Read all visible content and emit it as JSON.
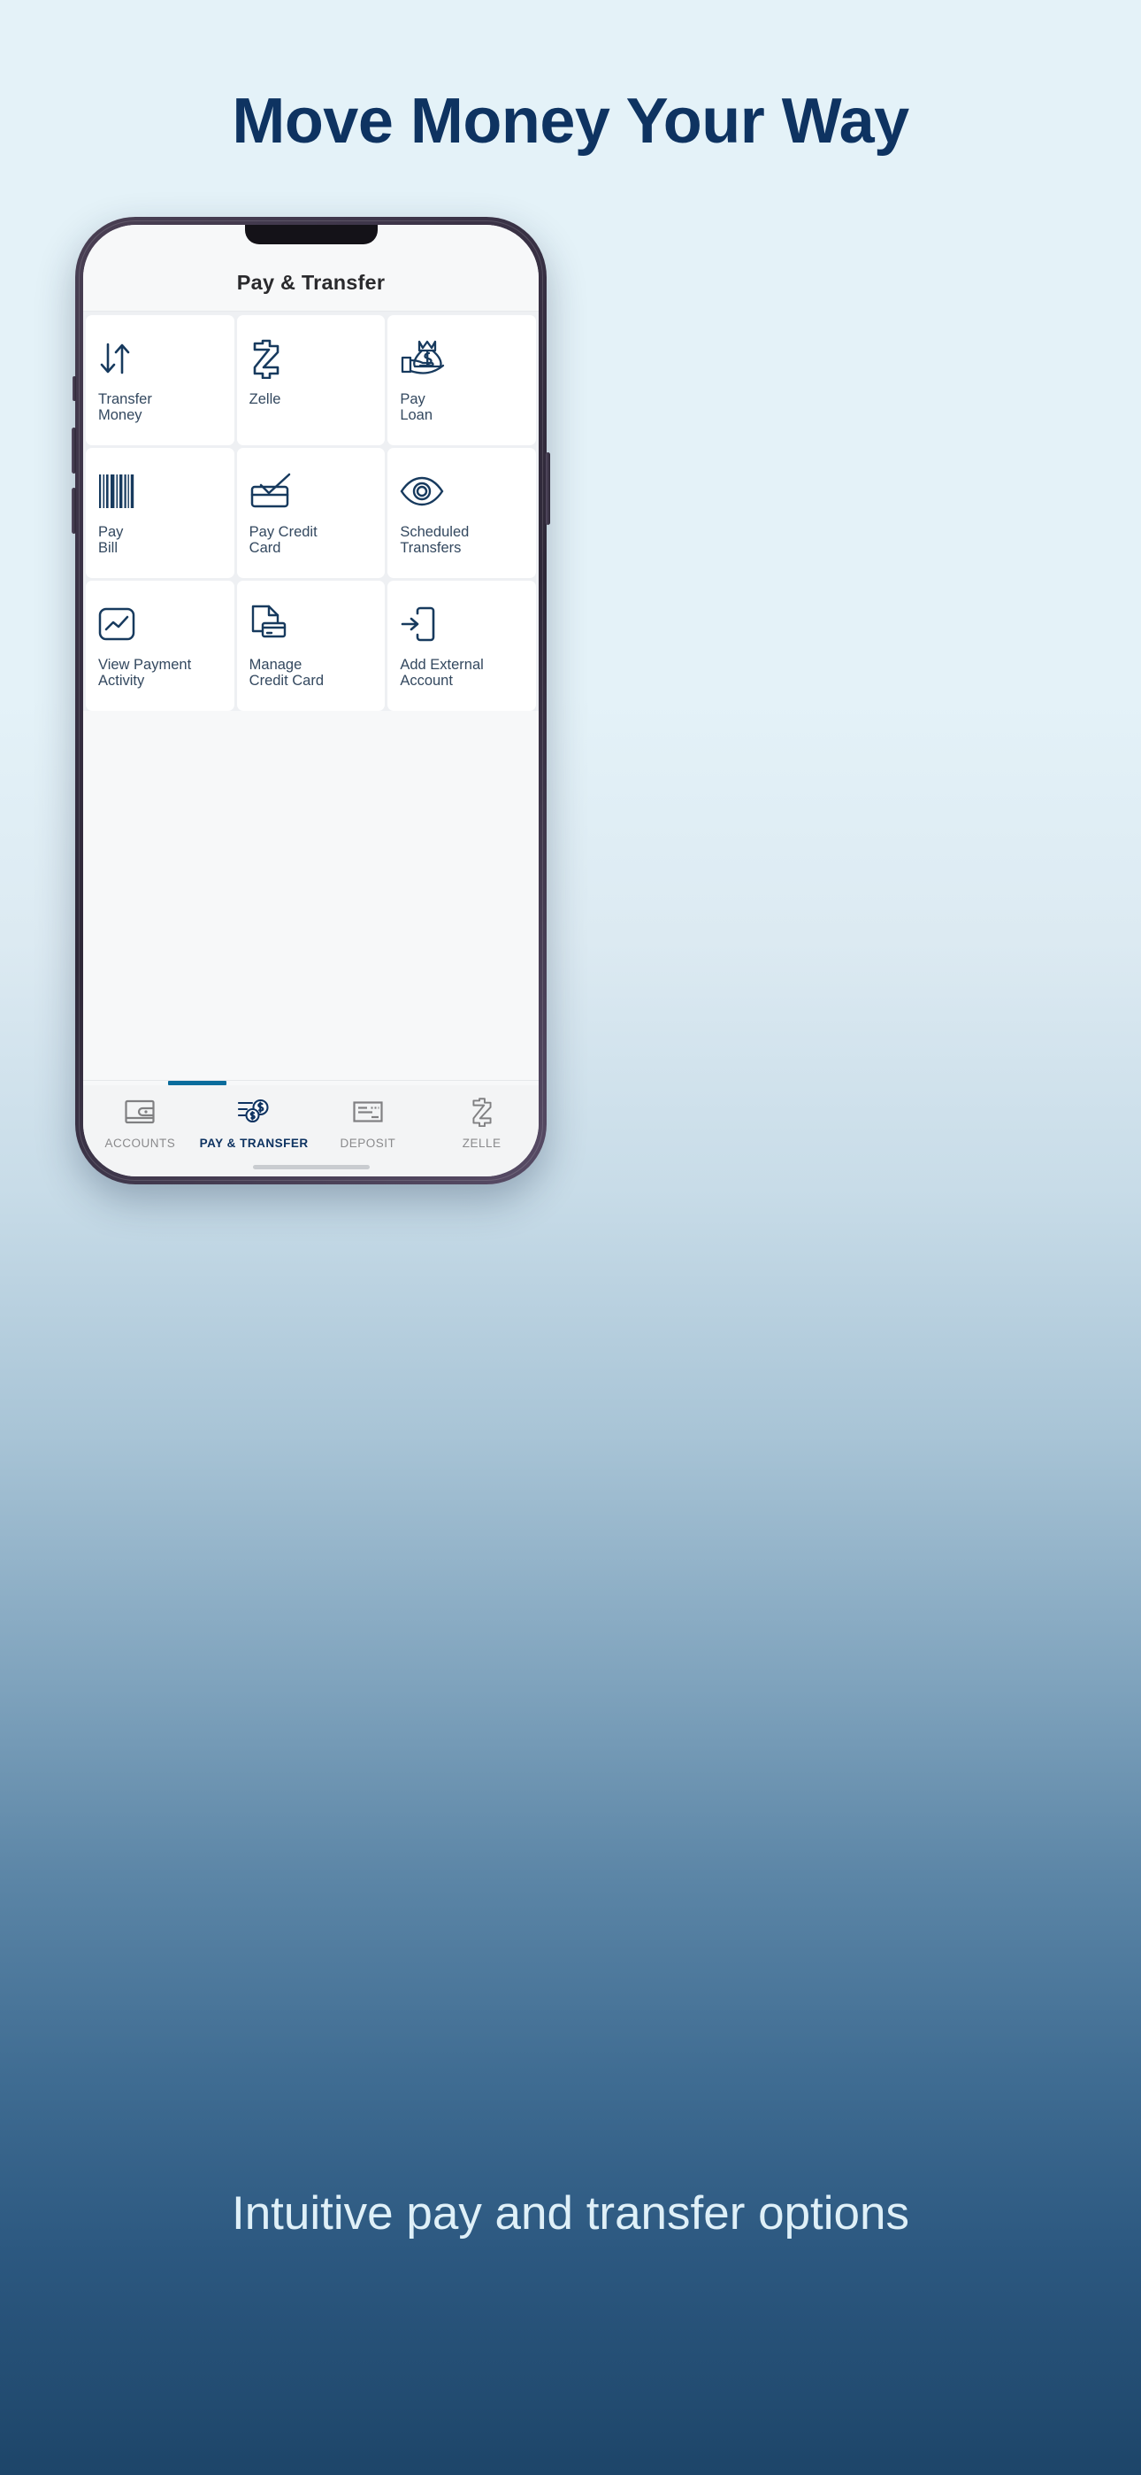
{
  "promo": {
    "headline": "Move Money Your Way",
    "caption": "Intuitive pay and transfer options",
    "headline_color": "#0e3361",
    "caption_color": "#dff0f8",
    "bg_top_color": "#e4f2f8",
    "bg_bottom_color": "#1d4569"
  },
  "app": {
    "header_title": "Pay & Transfer",
    "accent_color": "#0a6c9c",
    "icon_color": "#173a5e",
    "label_color": "#33485f",
    "tiles": [
      {
        "label": "Transfer\nMoney",
        "icon": "arrows-down-up-icon"
      },
      {
        "label": "Zelle",
        "icon": "zelle-logo-icon"
      },
      {
        "label": "Pay\nLoan",
        "icon": "hand-money-bag-icon"
      },
      {
        "label": "Pay\nBill",
        "icon": "barcode-icon"
      },
      {
        "label": "Pay Credit\nCard",
        "icon": "card-check-icon"
      },
      {
        "label": "Scheduled\nTransfers",
        "icon": "eye-icon"
      },
      {
        "label": "View Payment\nActivity",
        "icon": "chart-box-icon"
      },
      {
        "label": "Manage\nCredit Card",
        "icon": "document-card-icon"
      },
      {
        "label": "Add External\nAccount",
        "icon": "arrow-into-box-icon"
      }
    ],
    "tabs": [
      {
        "label": "ACCOUNTS",
        "icon": "wallet-icon",
        "active": false
      },
      {
        "label": "PAY & TRANSFER",
        "icon": "coins-transfer-icon",
        "active": true
      },
      {
        "label": "DEPOSIT",
        "icon": "check-icon",
        "active": false
      },
      {
        "label": "ZELLE",
        "icon": "zelle-logo-icon",
        "active": false
      }
    ]
  }
}
